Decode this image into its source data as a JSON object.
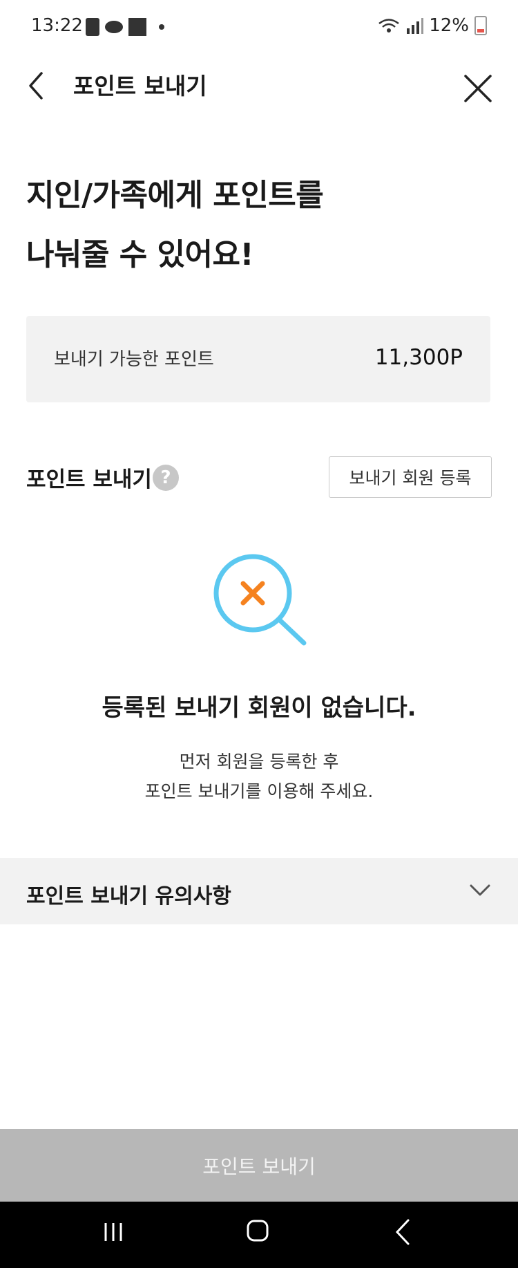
{
  "status_bar": {
    "time": "13:22",
    "battery": "12%"
  },
  "header": {
    "title": "포인트 보내기"
  },
  "headline": {
    "line1": "지인/가족에게 포인트를",
    "line2": "나눠줄 수 있어요!"
  },
  "points": {
    "label": "보내기 가능한 포인트",
    "value": "11,300P"
  },
  "send_section": {
    "title": "포인트 보내기",
    "help_symbol": "?",
    "register_button": "보내기 회원 등록"
  },
  "empty_state": {
    "title": "등록된 보내기 회원이 없습니다.",
    "desc_line1": "먼저 회원을 등록한 후",
    "desc_line2": "포인트 보내기를 이용해 주세요."
  },
  "notice": {
    "title": "포인트 보내기 유의사항"
  },
  "bottom_button": {
    "label": "포인트 보내기"
  },
  "icons": {
    "back": "chevron-left-icon",
    "close": "close-icon",
    "help": "question-icon",
    "empty": "search-x-icon",
    "expand": "chevron-down-icon",
    "nav_recents": "recents-icon",
    "nav_home": "home-icon",
    "nav_back": "back-icon"
  },
  "colors": {
    "accent_blue": "#5bc8f0",
    "accent_orange": "#f5821f",
    "disabled_button": "#b7b7b7"
  }
}
